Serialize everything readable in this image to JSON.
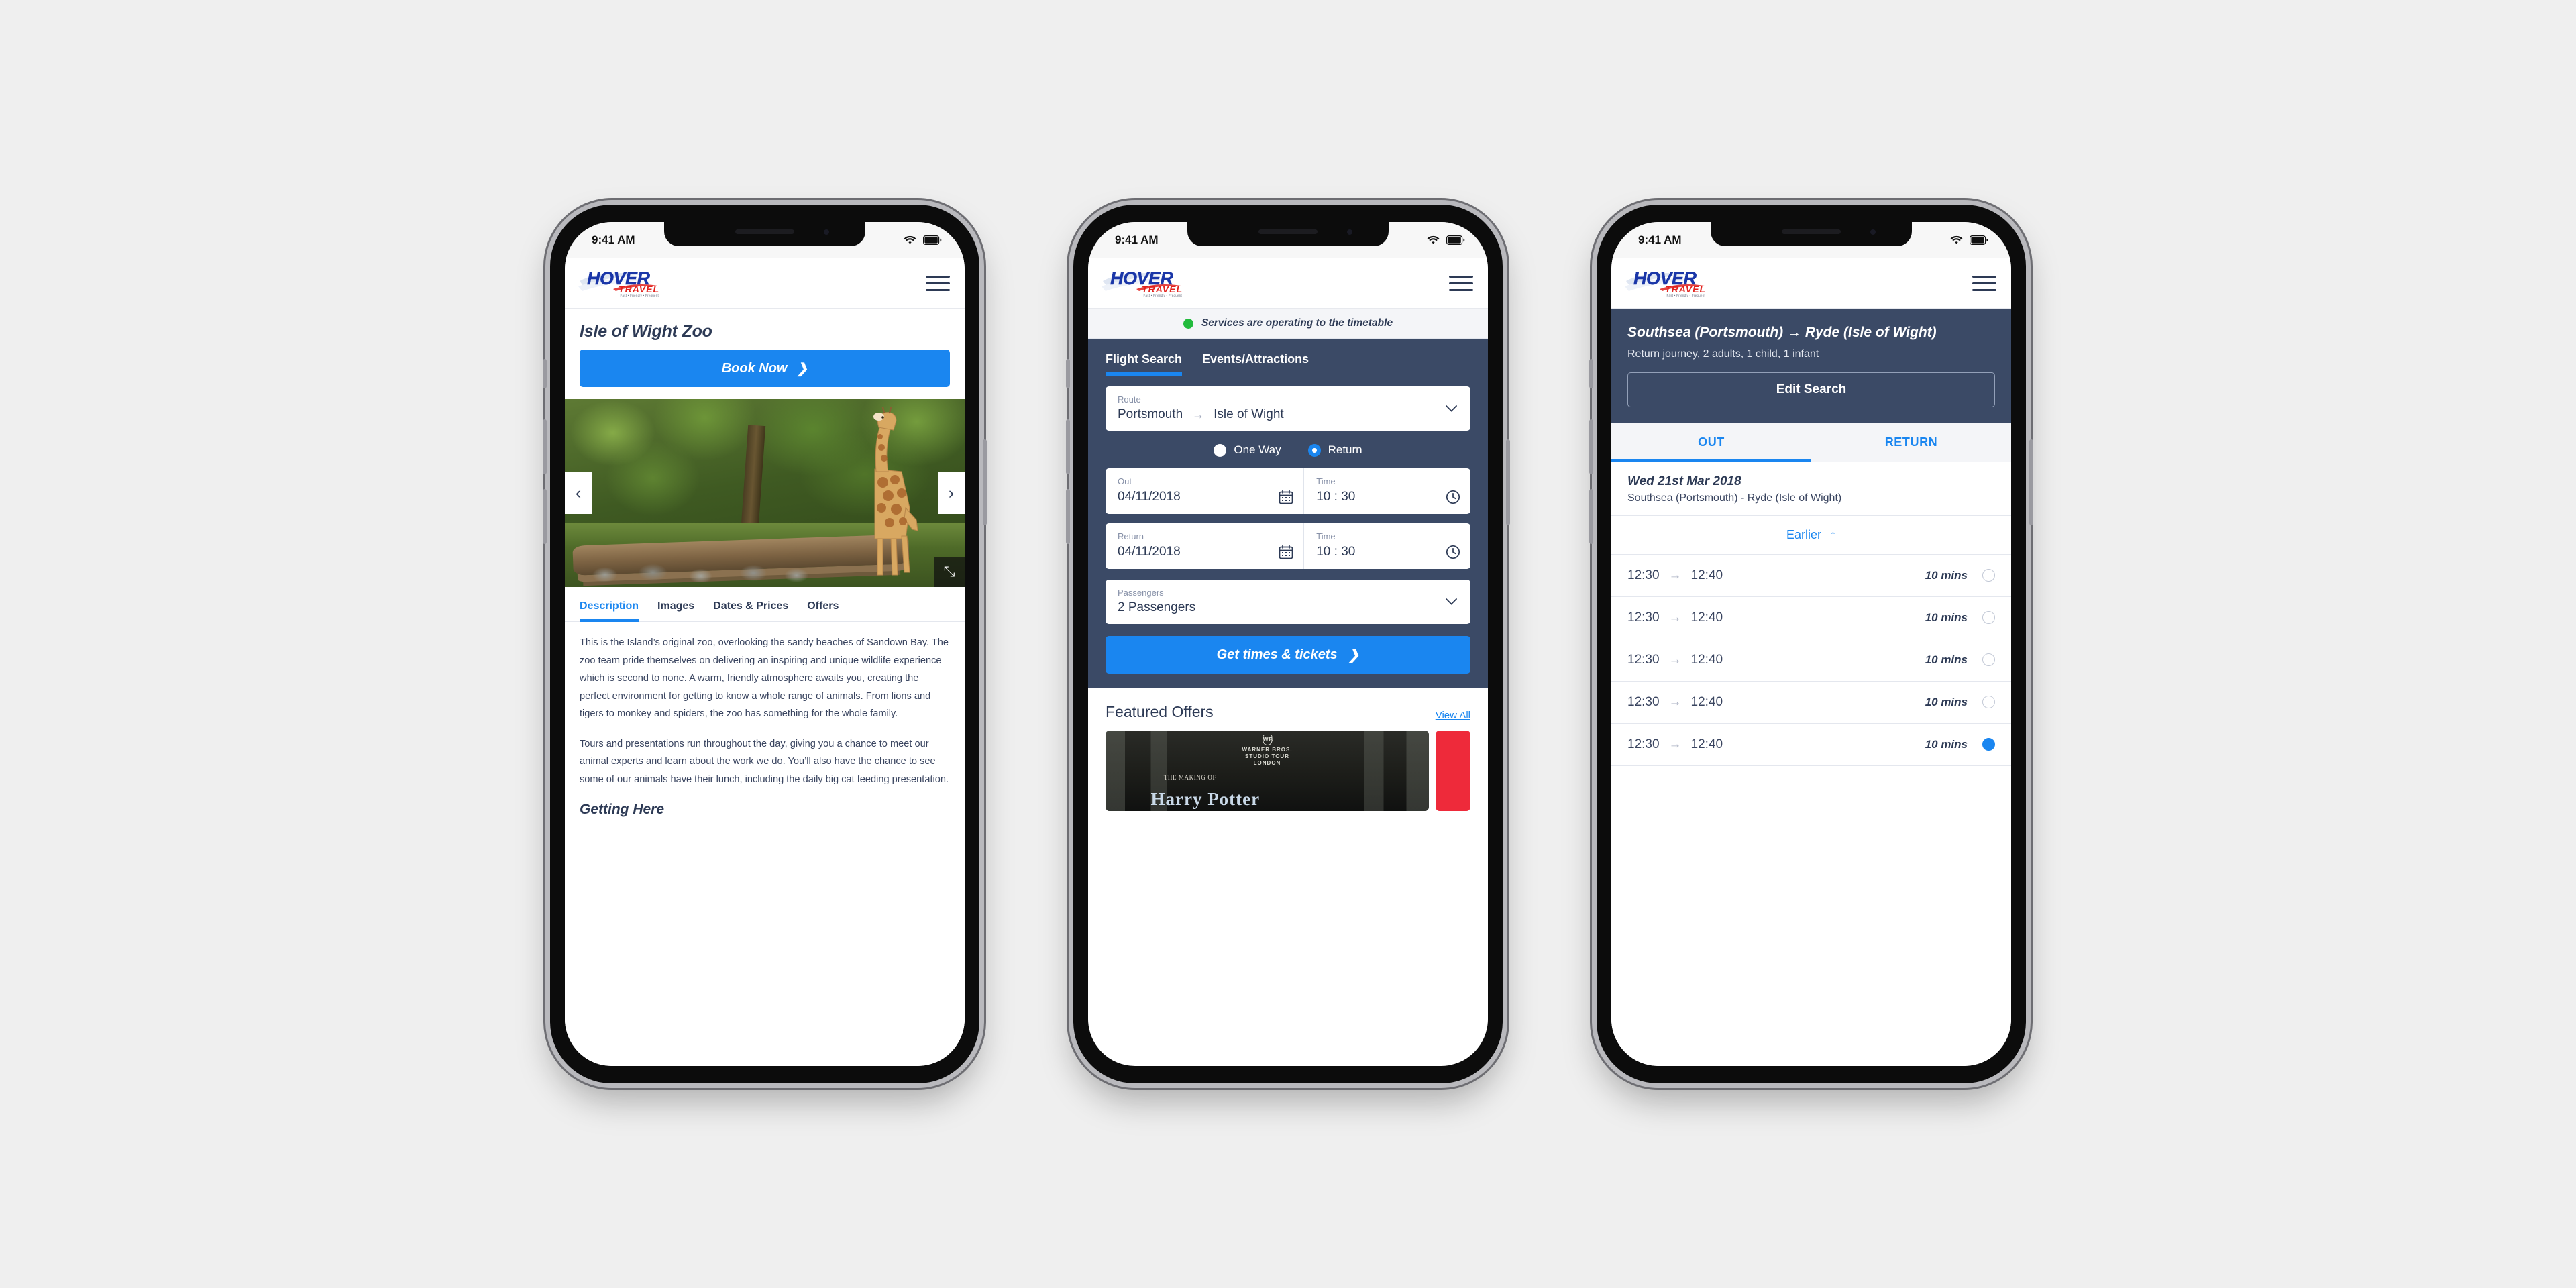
{
  "brand": {
    "logo_primary": "HOVER",
    "logo_secondary": "TRAVEL",
    "logo_tagline": "Fast • Friendly • Frequent",
    "accent_blue": "#1a86f0",
    "navy": "#3b4a66",
    "logo_blue": "#1a36a8",
    "logo_red": "#e2211c",
    "status_green": "#22bb3d"
  },
  "status_bar": {
    "time": "9:41 AM",
    "wifi": "wifi-icon",
    "battery": "battery-icon"
  },
  "phone1": {
    "page_title": "Isle of Wight Zoo",
    "book_now": "Book Now",
    "carousel": {
      "prev": "‹",
      "next": "›",
      "expand": "⤡",
      "image_alt": "giraffe-in-zoo-enclosure"
    },
    "tabs": [
      {
        "label": "Description",
        "active": true
      },
      {
        "label": "Images",
        "active": false
      },
      {
        "label": "Dates & Prices",
        "active": false
      },
      {
        "label": "Offers",
        "active": false
      }
    ],
    "paragraphs": [
      "This is the Island’s original zoo, overlooking the sandy beaches of Sandown Bay. The zoo team pride themselves on delivering an inspiring and unique wildlife experience which is second to none. A warm, friendly atmosphere awaits you, creating the perfect environment for getting to know a whole range of animals. From lions and tigers to monkey and spiders, the zoo has something for the whole family.",
      "Tours and presentations run throughout the day, giving you a chance to meet our animal experts and learn about the work we do. You’ll also have the chance to see some of our animals have their lunch, including the daily big cat feeding presentation."
    ],
    "next_section": "Getting Here"
  },
  "phone2": {
    "service_status": "Services are operating to the timetable",
    "panel_tabs": [
      {
        "label": "Flight Search",
        "active": true
      },
      {
        "label": "Events/Attractions",
        "active": false
      }
    ],
    "route": {
      "label": "Route",
      "from": "Portsmouth",
      "arrow": "→",
      "to": "Isle of Wight"
    },
    "trip_type": [
      {
        "label": "One Way",
        "selected": false
      },
      {
        "label": "Return",
        "selected": true
      }
    ],
    "out": {
      "label": "Out",
      "date": "04/11/2018",
      "time_label": "Time",
      "time": "10 : 30"
    },
    "return": {
      "label": "Return",
      "date": "04/11/2018",
      "time_label": "Time",
      "time": "10 : 30"
    },
    "passengers": {
      "label": "Passengers",
      "value": "2 Passengers"
    },
    "cta": "Get times & tickets",
    "offers": {
      "title": "Featured Offers",
      "view_all": "View All",
      "card1_brand_line1": "WARNER BROS.",
      "card1_brand_line2": "STUDIO TOUR",
      "card1_brand_line3": "LONDON",
      "card1_making": "THE MAKING OF",
      "card1_title": "Harry Potter"
    }
  },
  "phone3": {
    "journey_title": "Southsea (Portsmouth) → Ryde (Isle of Wight)",
    "journey_sub": "Return journey, 2 adults, 1 child, 1 infant",
    "edit_search": "Edit Search",
    "direction_tabs": [
      {
        "label": "OUT",
        "active": true
      },
      {
        "label": "RETURN",
        "active": false
      }
    ],
    "day_date": "Wed 21st Mar 2018",
    "day_route": "Southsea (Portsmouth) - Ryde (Isle of Wight)",
    "earlier": "Earlier",
    "earlier_arrow": "↑",
    "times": [
      {
        "depart": "12:30",
        "arrow": "→",
        "arrive": "12:40",
        "duration": "10 mins",
        "selected": false
      },
      {
        "depart": "12:30",
        "arrow": "→",
        "arrive": "12:40",
        "duration": "10 mins",
        "selected": false
      },
      {
        "depart": "12:30",
        "arrow": "→",
        "arrive": "12:40",
        "duration": "10 mins",
        "selected": false
      },
      {
        "depart": "12:30",
        "arrow": "→",
        "arrive": "12:40",
        "duration": "10 mins",
        "selected": false
      },
      {
        "depart": "12:30",
        "arrow": "→",
        "arrive": "12:40",
        "duration": "10 mins",
        "selected": true
      }
    ]
  }
}
